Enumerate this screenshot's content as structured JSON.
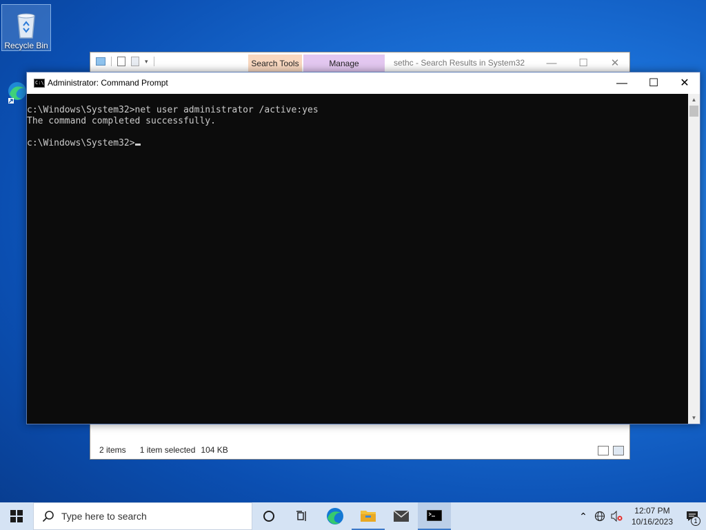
{
  "desktop": {
    "icons": [
      {
        "label": "Recycle Bin",
        "icon": "recycle-bin-icon"
      },
      {
        "label": "Microsoft Edge",
        "icon": "edge-shortcut-icon"
      }
    ]
  },
  "explorer": {
    "title": "sethc - Search Results in System32",
    "ribbon_tabs": [
      "Search Tools",
      "Manage"
    ],
    "status": {
      "items": "2 items",
      "selected": "1 item selected",
      "size": "104 KB"
    }
  },
  "cmd": {
    "title": "Administrator: Command Prompt",
    "lines": [
      "c:\\Windows\\System32>net user administrator /active:yes",
      "The command completed successfully.",
      "",
      "c:\\Windows\\System32>"
    ]
  },
  "taskbar": {
    "search_placeholder": "Type here to search",
    "time": "12:07 PM",
    "date": "10/16/2023",
    "notification_count": "1"
  },
  "colors": {
    "accent": "#3c78c8",
    "console_bg": "#0c0c0c",
    "console_fg": "#cccccc"
  }
}
